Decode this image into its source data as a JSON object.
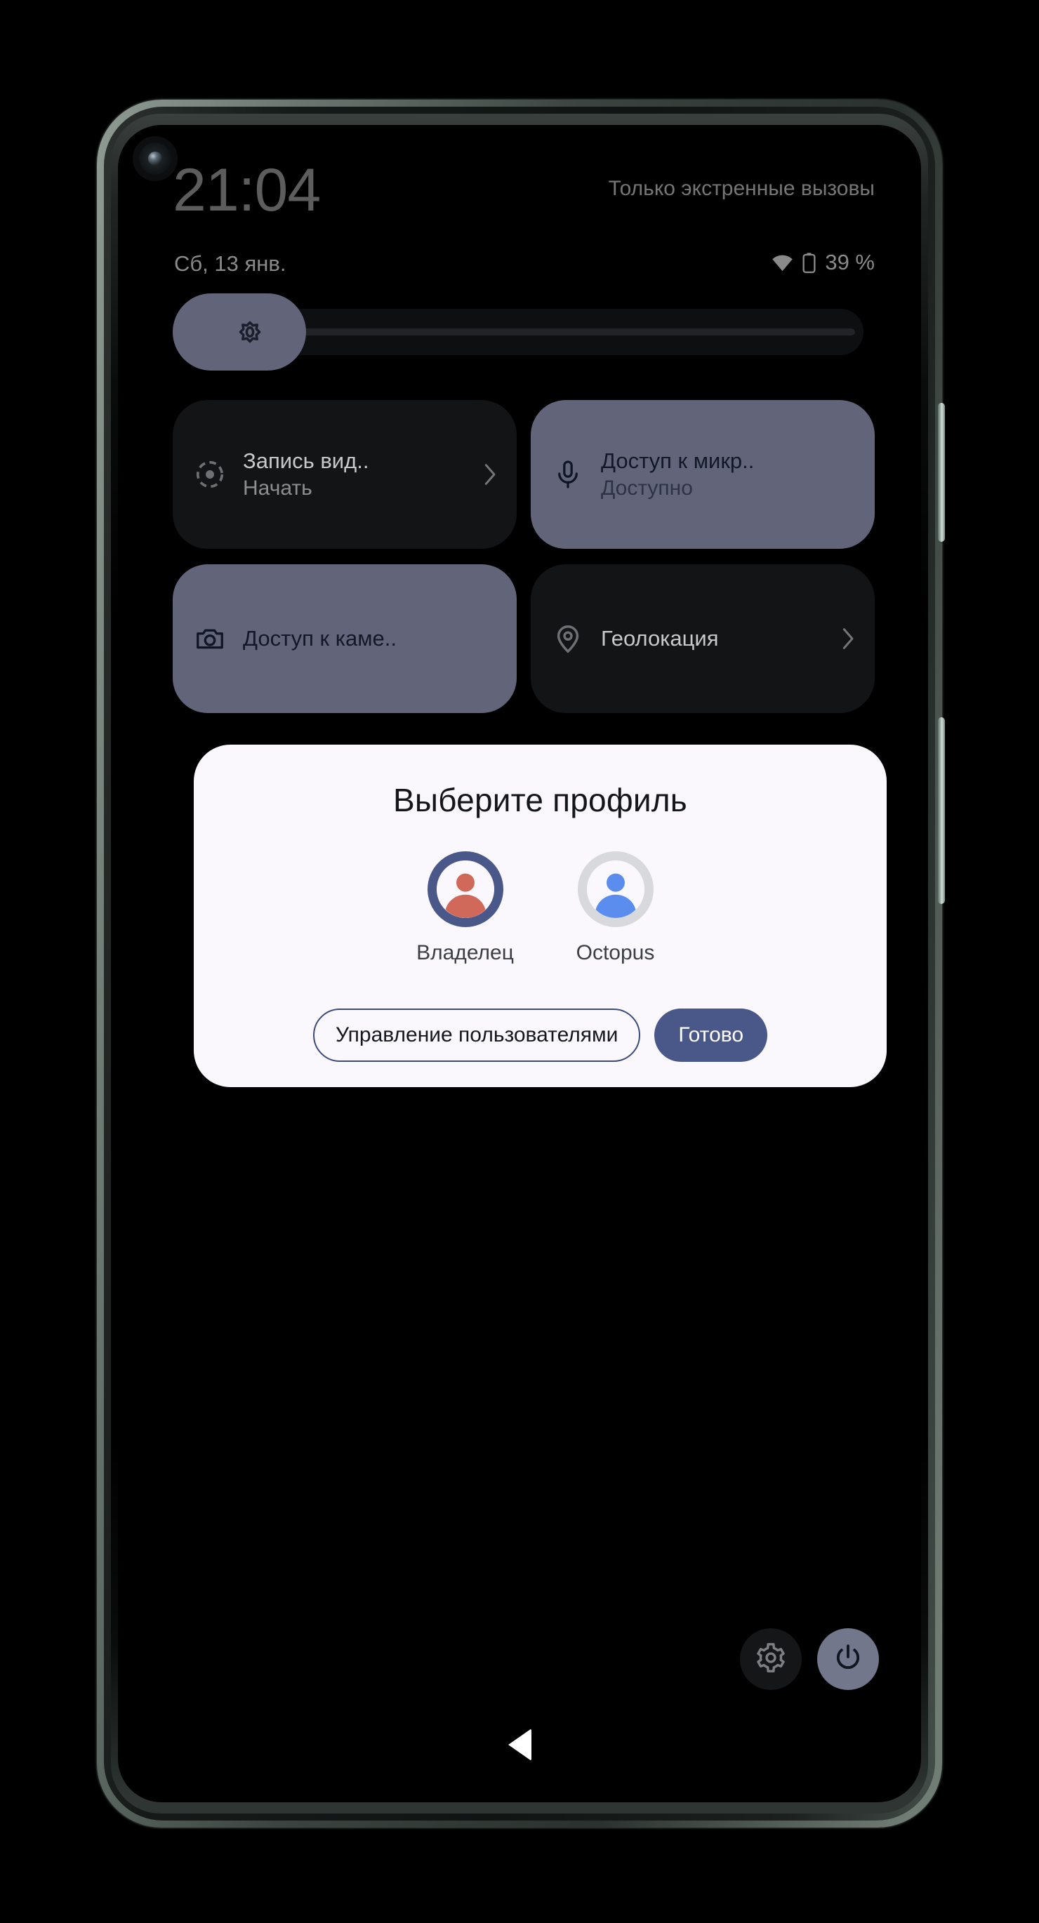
{
  "status": {
    "time": "21:04",
    "carrier": "Только экстренные вызовы",
    "date": "Сб, 13 янв.",
    "battery": "39 %",
    "wifi_icon": "wifi-icon",
    "battery_icon": "battery-icon"
  },
  "brightness": {
    "icon": "brightness-icon",
    "level_percent": 19
  },
  "tiles": [
    {
      "icon": "screen-record-icon",
      "title": "Запись вид..",
      "subtitle": "Начать",
      "state": "dark",
      "chevron": "chevron-right-icon",
      "name": "tile-screen-record"
    },
    {
      "icon": "microphone-icon",
      "title": "Доступ к микр..",
      "subtitle": "Доступно",
      "state": "light",
      "chevron": "",
      "name": "tile-microphone-access"
    },
    {
      "icon": "camera-icon",
      "title": "Доступ к каме..",
      "subtitle": "",
      "state": "light",
      "chevron": "",
      "name": "tile-camera-access"
    },
    {
      "icon": "location-icon",
      "title": "Геолокация",
      "subtitle": "",
      "state": "dark",
      "chevron": "chevron-right-icon",
      "name": "tile-location"
    }
  ],
  "dialog": {
    "title": "Выберите профиль",
    "profiles": [
      {
        "name": "Владелец",
        "selected": true,
        "ring_color": "#4a5789",
        "glyph_color": "#d0695a",
        "face_bg": "#faf7fd"
      },
      {
        "name": "Octopus",
        "selected": false,
        "ring_color": "#d7d9dd",
        "glyph_color": "#5b8def",
        "face_bg": "#faf7fd"
      }
    ],
    "manage_label": "Управление пользователями",
    "done_label": "Готово"
  },
  "shortcuts": [
    {
      "icon": "gear-icon",
      "name": "settings-shortcut"
    },
    {
      "icon": "power-icon",
      "name": "power-shortcut"
    }
  ],
  "navigation": {
    "back_icon": "back-triangle-icon"
  },
  "device": {
    "camera_icon": "front-camera-icon",
    "side_keys": [
      "power-key",
      "volume-key"
    ]
  }
}
